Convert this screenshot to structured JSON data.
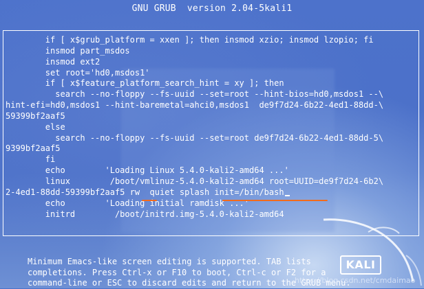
{
  "header": {
    "title": "GNU GRUB  version 2.04-5kali1"
  },
  "editor": {
    "lines": [
      "        if [ x$grub_platform = xxen ]; then insmod xzio; insmod lzopio; fi",
      "        insmod part_msdos",
      "        insmod ext2",
      "        set root='hd0,msdos1'",
      "        if [ x$feature_platform_search_hint = xy ]; then",
      "          search --no-floppy --fs-uuid --set=root --hint-bios=hd0,msdos1 --\\",
      "hint-efi=hd0,msdos1 --hint-baremetal=ahci0,msdos1  de9f7d24-6b22-4ed1-88dd-\\",
      "59399bf2aaf5",
      "        else",
      "          search --no-floppy --fs-uuid --set=root de9f7d24-6b22-4ed1-88dd-5\\",
      "9399bf2aaf5",
      "        fi",
      "        echo        'Loading Linux 5.4.0-kali2-amd64 ...'",
      "        linux        /boot/vmlinuz-5.4.0-kali2-amd64 root=UUID=de9f7d24-6b2\\",
      "2-4ed1-88dd-59399bf2aaf5 rw  quiet splash init=/bin/bash",
      "        echo        'Loading initial ramdisk ...'",
      "        initrd        /boot/initrd.img-5.4.0-kali2-amd64"
    ]
  },
  "footer": {
    "lines": [
      "Minimum Emacs-like screen editing is supported. TAB lists",
      "completions. Press Ctrl-x or F10 to boot, Ctrl-c or F2 for a",
      "command-line or ESC to discard edits and return to the GRUB menu."
    ]
  },
  "logo": {
    "text": "KALI"
  },
  "watermark": {
    "text": "https://blog.csdn.net/cmdaimao"
  },
  "colors": {
    "background": "#4a71c9",
    "text": "#ffffff",
    "annotation_underline": "#f26b1d"
  }
}
